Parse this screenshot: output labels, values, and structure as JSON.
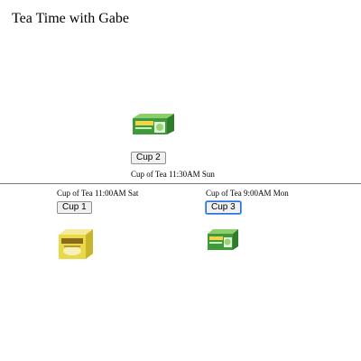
{
  "page": {
    "title": "Tea Time with Gabe"
  },
  "cards": {
    "cup2": {
      "button_label": "Cup 2",
      "caption": "Cup of Tea 11:30AM Sun",
      "image_icon": "green-tea-box-icon"
    },
    "cup1": {
      "button_label": "Cup 1",
      "caption": "Cup of Tea 11:00AM Sat",
      "image_icon": "yellow-tea-box-icon"
    },
    "cup3": {
      "button_label": "Cup 3",
      "caption": "Cup of Tea 9:00AM Mon",
      "image_icon": "green-tea-box-icon",
      "focused": true
    }
  },
  "colors": {
    "divider": "#7a7a7a",
    "focus_ring": "#2b6fd6",
    "green_box": "#3f9b3a",
    "yellow_box": "#e8d84a"
  }
}
